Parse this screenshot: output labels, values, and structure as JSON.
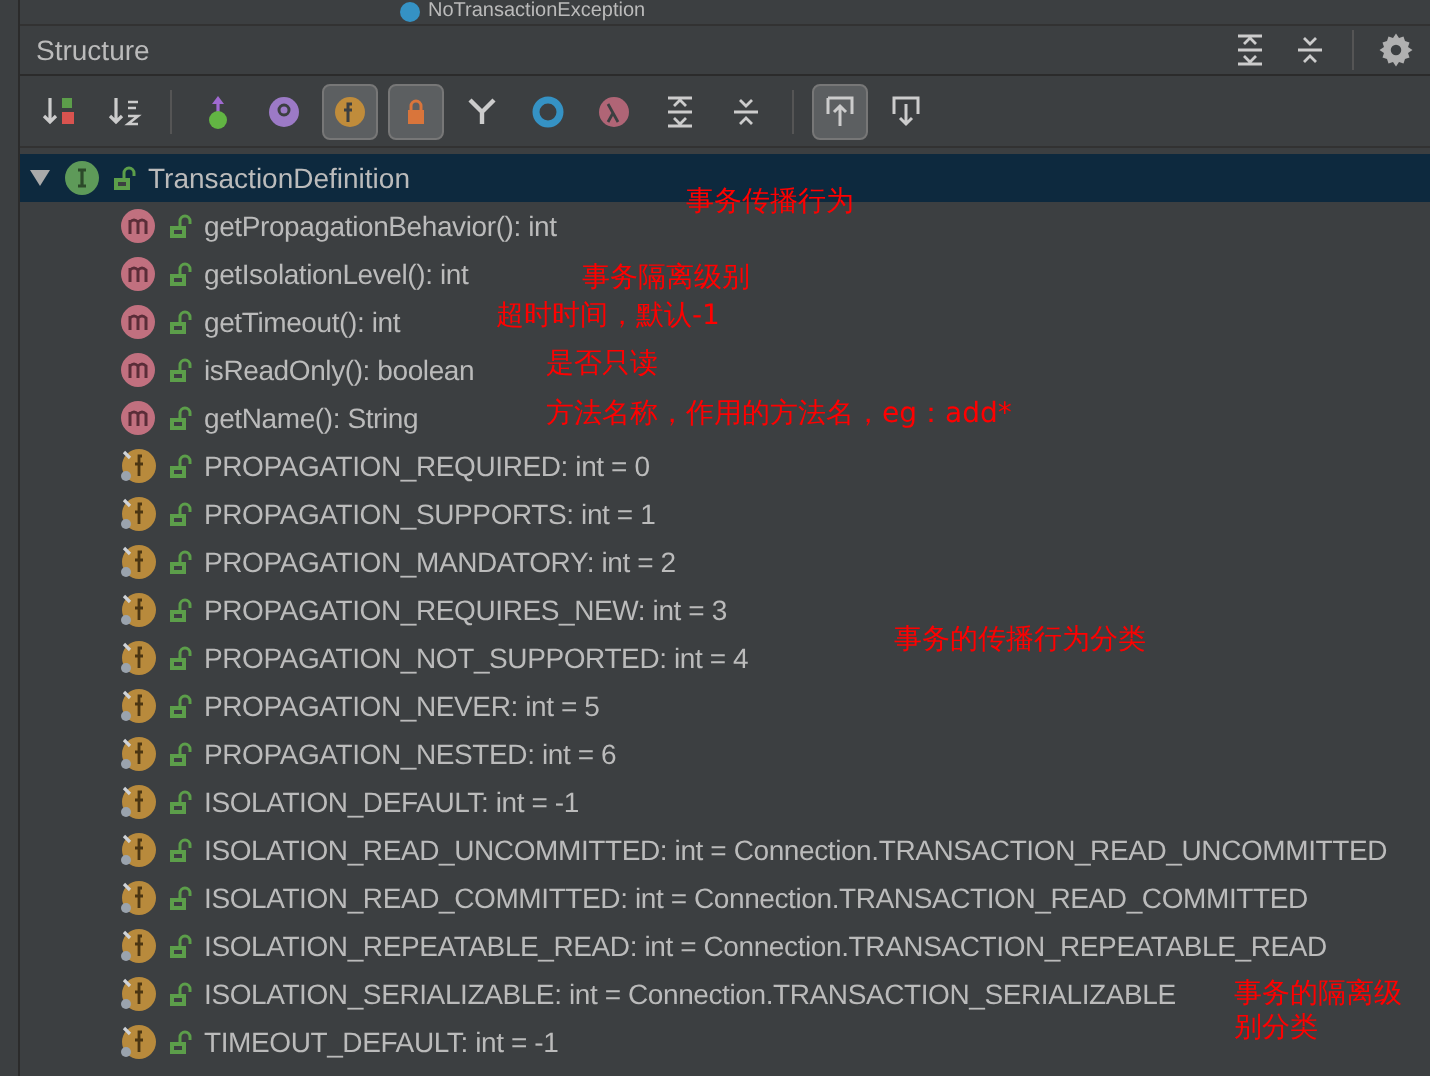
{
  "editor_tab": {
    "title": "NoTransactionException"
  },
  "panel": {
    "title": "Structure"
  },
  "toolbar": [
    {
      "kind": "sort-visibility",
      "selected": false
    },
    {
      "kind": "sort-alpha",
      "selected": false
    },
    {
      "kind": "inherited",
      "selected": false
    },
    {
      "kind": "properties",
      "selected": false
    },
    {
      "kind": "fields",
      "selected": true
    },
    {
      "kind": "non-public",
      "selected": true
    },
    {
      "kind": "lambdas-tree",
      "selected": false
    },
    {
      "kind": "anonymous",
      "selected": false
    },
    {
      "kind": "lambdas",
      "selected": false
    },
    {
      "kind": "expand",
      "selected": false
    },
    {
      "kind": "collapse",
      "selected": false
    },
    {
      "kind": "autoscroll-to",
      "selected": true
    },
    {
      "kind": "autoscroll-from",
      "selected": false
    }
  ],
  "tree": {
    "root": {
      "label": "TransactionDefinition",
      "expanded": true,
      "selected": true,
      "children": [
        {
          "kind": "method",
          "label": "getPropagationBehavior(): int"
        },
        {
          "kind": "method",
          "label": "getIsolationLevel(): int"
        },
        {
          "kind": "method",
          "label": "getTimeout(): int"
        },
        {
          "kind": "method",
          "label": "isReadOnly(): boolean"
        },
        {
          "kind": "method",
          "label": "getName(): String"
        },
        {
          "kind": "field",
          "label": "PROPAGATION_REQUIRED: int = 0"
        },
        {
          "kind": "field",
          "label": "PROPAGATION_SUPPORTS: int = 1"
        },
        {
          "kind": "field",
          "label": "PROPAGATION_MANDATORY: int = 2"
        },
        {
          "kind": "field",
          "label": "PROPAGATION_REQUIRES_NEW: int = 3"
        },
        {
          "kind": "field",
          "label": "PROPAGATION_NOT_SUPPORTED: int = 4"
        },
        {
          "kind": "field",
          "label": "PROPAGATION_NEVER: int = 5"
        },
        {
          "kind": "field",
          "label": "PROPAGATION_NESTED: int = 6"
        },
        {
          "kind": "field",
          "label": "ISOLATION_DEFAULT: int = -1"
        },
        {
          "kind": "field",
          "label": "ISOLATION_READ_UNCOMMITTED: int = Connection.TRANSACTION_READ_UNCOMMITTED"
        },
        {
          "kind": "field",
          "label": "ISOLATION_READ_COMMITTED: int = Connection.TRANSACTION_READ_COMMITTED"
        },
        {
          "kind": "field",
          "label": "ISOLATION_REPEATABLE_READ: int = Connection.TRANSACTION_REPEATABLE_READ"
        },
        {
          "kind": "field",
          "label": "ISOLATION_SERIALIZABLE: int = Connection.TRANSACTION_SERIALIZABLE"
        },
        {
          "kind": "field",
          "label": "TIMEOUT_DEFAULT: int = -1"
        }
      ]
    }
  },
  "annotations": [
    {
      "text": "事务传播行为"
    },
    {
      "text": "事务隔离级别"
    },
    {
      "text": "超时时间，默认-1"
    },
    {
      "text": "是否只读"
    },
    {
      "text": "方法名称，作用的方法名，eg：add*"
    },
    {
      "text": "事务的传播行为分类"
    },
    {
      "text": "事务的隔离级别分类"
    }
  ]
}
